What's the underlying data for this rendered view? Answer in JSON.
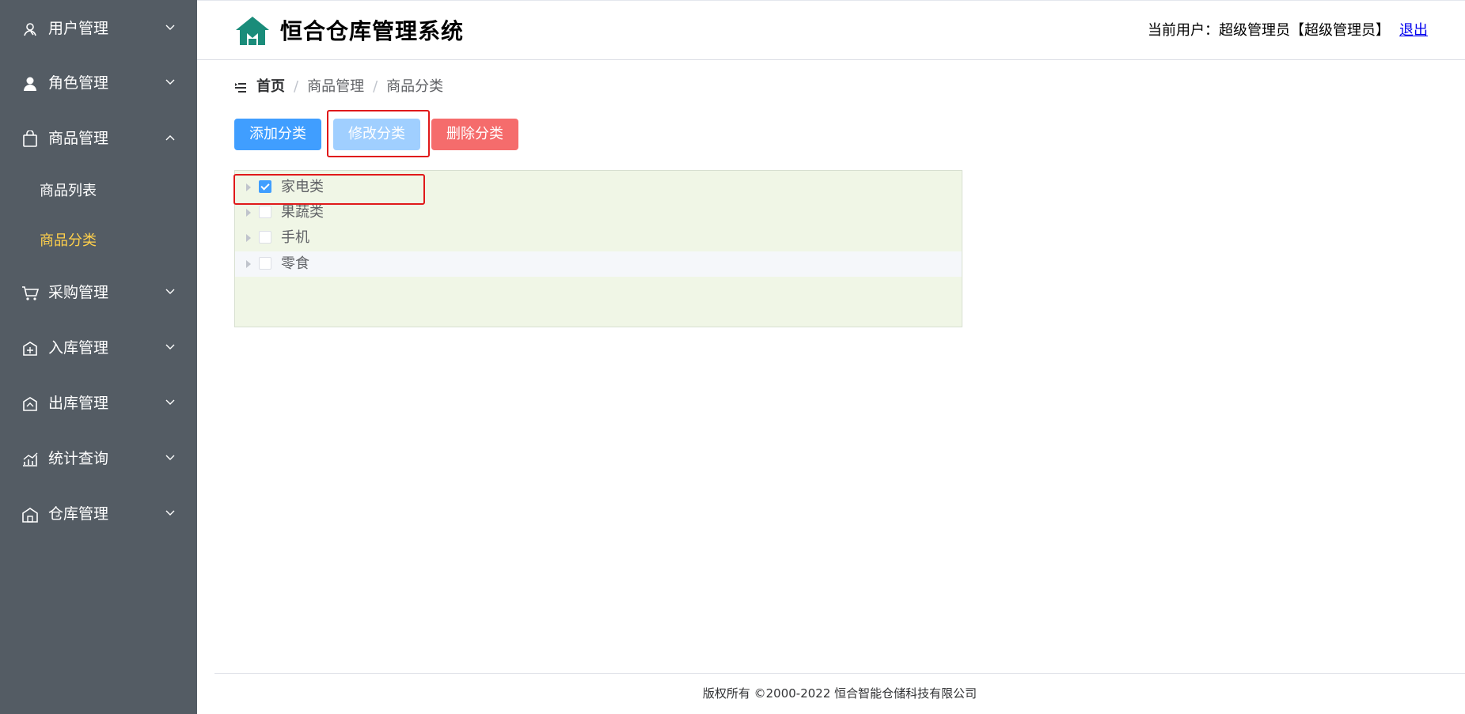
{
  "header": {
    "app_title": "恒合仓库管理系统",
    "user_prefix": "当前用户：",
    "user_name": "超级管理员【超级管理员】",
    "logout": "退出"
  },
  "sidebar": {
    "items": [
      {
        "label": "用户管理",
        "icon": "user-icon",
        "expanded": false
      },
      {
        "label": "角色管理",
        "icon": "role-icon",
        "expanded": false
      },
      {
        "label": "商品管理",
        "icon": "shopping-bag-icon",
        "expanded": true
      },
      {
        "label": "采购管理",
        "icon": "cart-icon",
        "expanded": false
      },
      {
        "label": "入库管理",
        "icon": "inbound-icon",
        "expanded": false
      },
      {
        "label": "出库管理",
        "icon": "outbound-icon",
        "expanded": false
      },
      {
        "label": "统计查询",
        "icon": "stats-icon",
        "expanded": false
      },
      {
        "label": "仓库管理",
        "icon": "warehouse-icon",
        "expanded": false
      }
    ],
    "sub_items": [
      {
        "label": "商品列表",
        "active": false
      },
      {
        "label": "商品分类",
        "active": true
      }
    ],
    "active_color": "#ffd04b",
    "bg_color": "#545c64"
  },
  "breadcrumb": {
    "home": "首页",
    "items": [
      "商品管理",
      "商品分类"
    ],
    "separator": "/"
  },
  "toolbar": {
    "add_label": "添加分类",
    "edit_label": "修改分类",
    "delete_label": "删除分类"
  },
  "tree": {
    "nodes": [
      {
        "label": "家电类",
        "checked": true
      },
      {
        "label": "果蔬类",
        "checked": false
      },
      {
        "label": "手机",
        "checked": false
      },
      {
        "label": "零食",
        "checked": false
      }
    ]
  },
  "footer": {
    "text": "版权所有 ©2000-2022  恒合智能仓储科技有限公司"
  },
  "colors": {
    "primary": "#409eff",
    "danger": "#f56c6c",
    "highlight": "#e0191a",
    "logo": "#1a8c7a"
  }
}
